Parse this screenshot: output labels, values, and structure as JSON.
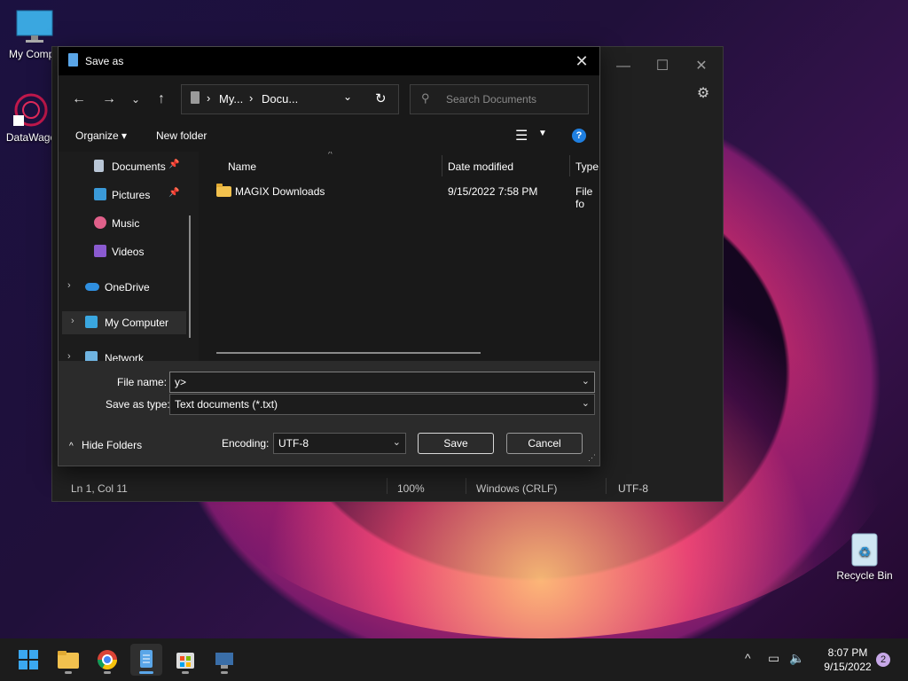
{
  "desktop": {
    "icons": [
      {
        "label": "My Compu"
      },
      {
        "label": "DataWago"
      },
      {
        "label": "Recycle Bin"
      }
    ]
  },
  "notepad": {
    "status": {
      "position": "Ln 1, Col 11",
      "zoom": "100%",
      "line_ending": "Windows (CRLF)",
      "encoding": "UTF-8"
    }
  },
  "dialog": {
    "title": "Save as",
    "breadcrumb": [
      "My...",
      "Docu..."
    ],
    "search_placeholder": "Search Documents",
    "commands": {
      "organize": "Organize",
      "new_folder": "New folder"
    },
    "nav": [
      {
        "label": "Documents",
        "pinned": true
      },
      {
        "label": "Pictures",
        "pinned": true
      },
      {
        "label": "Music"
      },
      {
        "label": "Videos"
      },
      {
        "label": "OneDrive"
      },
      {
        "label": "My Computer",
        "selected": true
      },
      {
        "label": "Network"
      }
    ],
    "columns": {
      "name": "Name",
      "date": "Date modified",
      "type": "Type"
    },
    "files": [
      {
        "name": "MAGIX Downloads",
        "date": "9/15/2022 7:58 PM",
        "type": "File fo"
      }
    ],
    "file_name_label": "File name:",
    "file_name_value": "y>",
    "save_type_label": "Save as type:",
    "save_type_value": "Text documents (*.txt)",
    "hide_folders": "Hide Folders",
    "encoding_label": "Encoding:",
    "encoding_value": "UTF-8",
    "save_button": "Save",
    "cancel_button": "Cancel"
  },
  "taskbar": {
    "time": "8:07 PM",
    "date": "9/15/2022",
    "notification_count": "2"
  },
  "colors": {
    "accent": "#1f7fe0",
    "folder": "#f2c14e",
    "dialog_bg": "#1c1c1c"
  }
}
